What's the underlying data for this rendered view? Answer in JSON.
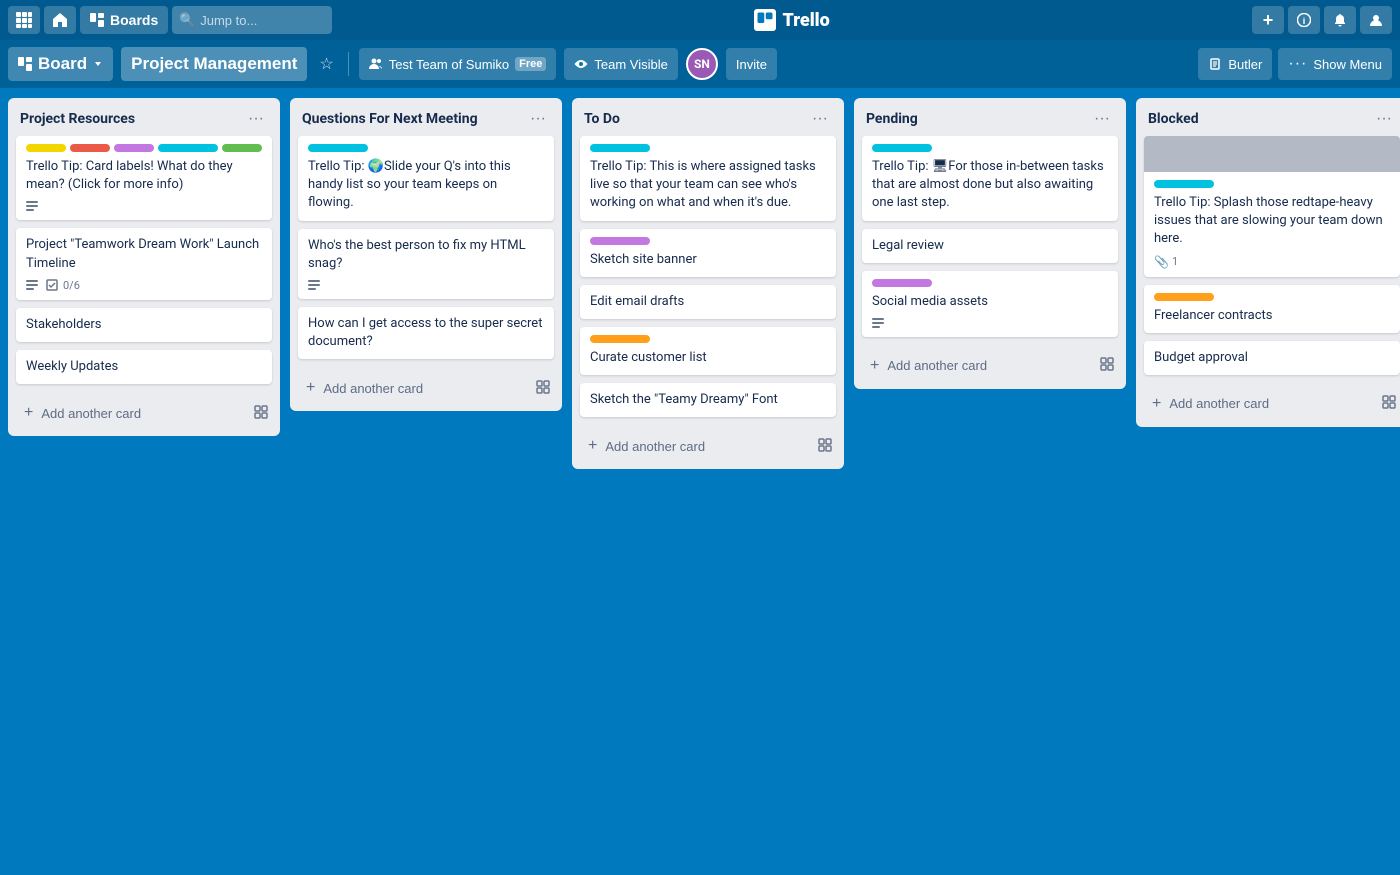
{
  "topnav": {
    "apps_label": "⊞",
    "home_label": "🏠",
    "boards_label": "Boards",
    "search_placeholder": "Jump to...",
    "title": "Trello",
    "plus_label": "+",
    "info_label": "ℹ",
    "bell_label": "🔔",
    "user_label": "👤"
  },
  "boardheader": {
    "board_label": "Board",
    "title": "Project Management",
    "team_label": "Test Team of Sumiko",
    "free_label": "Free",
    "visibility_label": "Team Visible",
    "invite_label": "Invite",
    "butler_label": "Butler",
    "show_menu_label": "Show Menu",
    "avatar_initials": "SN"
  },
  "lists": [
    {
      "id": "project-resources",
      "title": "Project Resources",
      "cards": [
        {
          "id": "card-tip-labels",
          "labels": [
            {
              "color": "label-yellow"
            },
            {
              "color": "label-red"
            },
            {
              "color": "label-purple"
            },
            {
              "color": "label-teal wide"
            },
            {
              "color": "label-green"
            }
          ],
          "text": "Trello Tip: Card labels! What do they mean? (Click for more info)",
          "footer": {
            "description": true
          }
        },
        {
          "id": "card-launch-timeline",
          "labels": [],
          "text": "Project \"Teamwork Dream Work\" Launch Timeline",
          "footer": {
            "description": true,
            "checklist": "0/6"
          }
        },
        {
          "id": "card-stakeholders",
          "labels": [],
          "text": "Stakeholders",
          "footer": {}
        },
        {
          "id": "card-weekly-updates",
          "labels": [],
          "text": "Weekly Updates",
          "footer": {}
        }
      ],
      "add_label": "Add another card"
    },
    {
      "id": "questions-next-meeting",
      "title": "Questions For Next Meeting",
      "cards": [
        {
          "id": "card-tip-slide",
          "labels": [
            {
              "color": "label-teal wide"
            }
          ],
          "text": "Trello Tip: 🌍Slide your Q's into this handy list so your team keeps on flowing.",
          "footer": {}
        },
        {
          "id": "card-html-snag",
          "labels": [],
          "text": "Who's the best person to fix my HTML snag?",
          "footer": {
            "description": true
          }
        },
        {
          "id": "card-secret-doc",
          "labels": [],
          "text": "How can I get access to the super secret document?",
          "footer": {}
        }
      ],
      "add_label": "Add another card"
    },
    {
      "id": "to-do",
      "title": "To Do",
      "cards": [
        {
          "id": "card-tip-todo",
          "labels": [
            {
              "color": "label-teal wide"
            }
          ],
          "text": "Trello Tip: This is where assigned tasks live so that your team can see who's working on what and when it's due.",
          "footer": {}
        },
        {
          "id": "card-sketch-banner",
          "labels": [
            {
              "color": "label-purple wide"
            }
          ],
          "text": "Sketch site banner",
          "footer": {}
        },
        {
          "id": "card-edit-email",
          "labels": [],
          "text": "Edit email drafts",
          "footer": {}
        },
        {
          "id": "card-curate-customer",
          "labels": [
            {
              "color": "label-orange wide"
            }
          ],
          "text": "Curate customer list",
          "footer": {}
        },
        {
          "id": "card-sketch-font",
          "labels": [],
          "text": "Sketch the \"Teamy Dreamy\" Font",
          "footer": {}
        }
      ],
      "add_label": "Add another card"
    },
    {
      "id": "pending",
      "title": "Pending",
      "cards": [
        {
          "id": "card-tip-pending",
          "labels": [
            {
              "color": "label-teal wide"
            }
          ],
          "text": "Trello Tip: 🖥For those in-between tasks that are almost done but also awaiting one last step.",
          "footer": {}
        },
        {
          "id": "card-legal-review",
          "labels": [],
          "text": "Legal review",
          "footer": {}
        },
        {
          "id": "card-social-media",
          "labels": [
            {
              "color": "label-purple wide"
            }
          ],
          "text": "Social media assets",
          "footer": {
            "description": true
          }
        }
      ],
      "add_label": "Add another card"
    },
    {
      "id": "blocked",
      "title": "Blocked",
      "cards": [
        {
          "id": "card-tip-blocked",
          "has_color_header": true,
          "header_color": "gray",
          "labels": [
            {
              "color": "label-teal wide"
            }
          ],
          "text": "Trello Tip: Splash those redtape-heavy issues that are slowing your team down here.",
          "footer": {
            "attachment": "1"
          }
        },
        {
          "id": "card-freelancer",
          "labels": [
            {
              "color": "label-orange wide"
            }
          ],
          "text": "Freelancer contracts",
          "footer": {}
        },
        {
          "id": "card-budget-approval",
          "labels": [],
          "text": "Budget approval",
          "footer": {}
        }
      ],
      "add_label": "Add another card"
    }
  ]
}
